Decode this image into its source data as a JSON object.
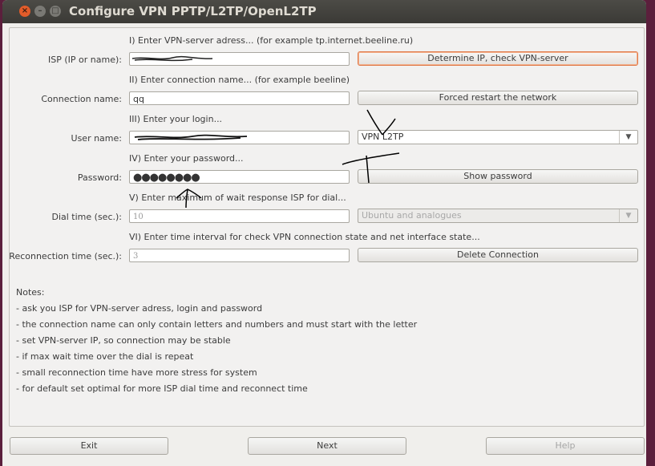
{
  "window": {
    "title": "Configure VPN PPTP/L2TP/OpenL2TP"
  },
  "sections": {
    "isp": {
      "caption": "I) Enter VPN-server adress... (for example tp.internet.beeline.ru)",
      "label": "ISP (IP or name):",
      "value": "",
      "button": "Determine IP, check VPN-server"
    },
    "conn": {
      "caption": "II) Enter connection name... (for example beeline)",
      "label": "Connection name:",
      "value": "qq",
      "button": "Forced restart the network"
    },
    "login": {
      "caption": "III) Enter your login...",
      "label": "User name:",
      "value": "",
      "vpn_type": "VPN L2TP"
    },
    "password": {
      "caption": "IV) Enter your password...",
      "label": "Password:",
      "value": "●●●●●●●●",
      "button": "Show password"
    },
    "dial": {
      "caption": "V) Enter maximum of wait response ISP for dial...",
      "label": "Dial time (sec.):",
      "value": "10",
      "distro": "Ubuntu and analogues"
    },
    "reconnect": {
      "caption": "VI) Enter time interval for check VPN connection state and net interface state...",
      "label": "Reconnection time (sec.):",
      "value": "3",
      "button": "Delete Connection"
    }
  },
  "notes": {
    "heading": "Notes:",
    "items": [
      "- ask you ISP for VPN-server adress, login and password",
      "- the connection name can only contain letters and numbers and must start with the letter",
      "- set VPN-server IP, so connection may be stable",
      "- if max wait time over the dial is repeat",
      "- small reconnection time have more stress for system",
      "- for default set optimal for more ISP dial time and reconnect time"
    ]
  },
  "footer": {
    "exit": "Exit",
    "next": "Next",
    "help": "Help"
  },
  "icons": {
    "close": "close-icon",
    "minimize": "minimize-icon",
    "maximize": "maximize-icon",
    "dropdown": "chevron-down-icon"
  },
  "colors": {
    "titlebar": "#3b3a36",
    "close_button": "#e25c2a",
    "focus_border": "#e07a4a",
    "desktop": "#5b1f3c"
  }
}
